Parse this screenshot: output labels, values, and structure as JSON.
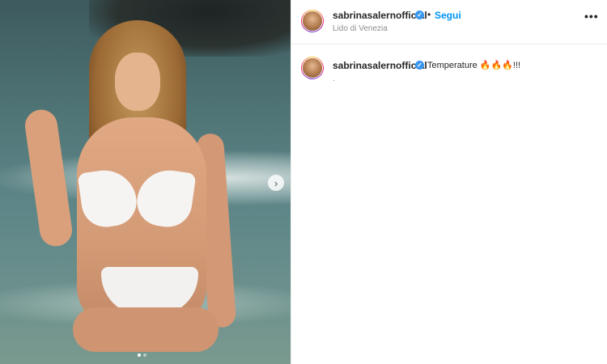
{
  "post": {
    "username": "sabrinasalernofficial",
    "follow_label": "Segui",
    "location": "Lido di Venezia",
    "more_icon": "more-options-icon",
    "caption": "Temperature 🔥🔥🔥!!!",
    "caption_extra": "."
  },
  "media": {
    "next_arrow": "›",
    "slides": 2,
    "active_slide": 1
  },
  "colors": {
    "follow_blue": "#0095f6",
    "verified_blue": "#3897f0",
    "text_primary": "#262626",
    "text_secondary": "#8e8e8e"
  }
}
